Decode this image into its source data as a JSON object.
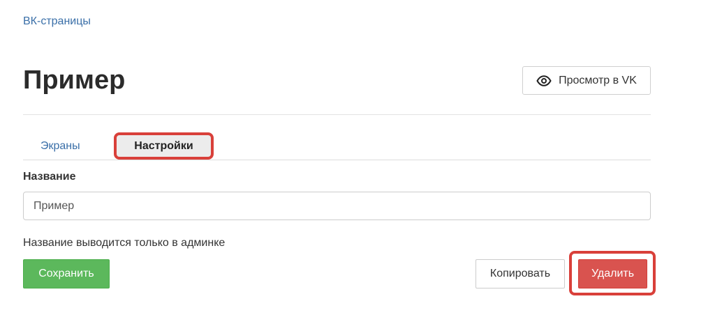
{
  "breadcrumb": {
    "label": "ВК-страницы"
  },
  "header": {
    "title": "Пример",
    "view_button": {
      "label": "Просмотр в VK",
      "icon": "eye-icon"
    }
  },
  "tabs": [
    {
      "label": "Экраны",
      "active": false
    },
    {
      "label": "Настройки",
      "active": true,
      "highlighted": true
    }
  ],
  "form": {
    "name_label": "Название",
    "name_value": "Пример",
    "help_text": "Название выводится только в админке"
  },
  "actions": {
    "save_label": "Сохранить",
    "copy_label": "Копировать",
    "delete_label": "Удалить",
    "delete_highlighted": true
  },
  "colors": {
    "link": "#3a6fa8",
    "save": "#5cb85c",
    "delete": "#d9534f",
    "highlight": "#d9403a"
  }
}
